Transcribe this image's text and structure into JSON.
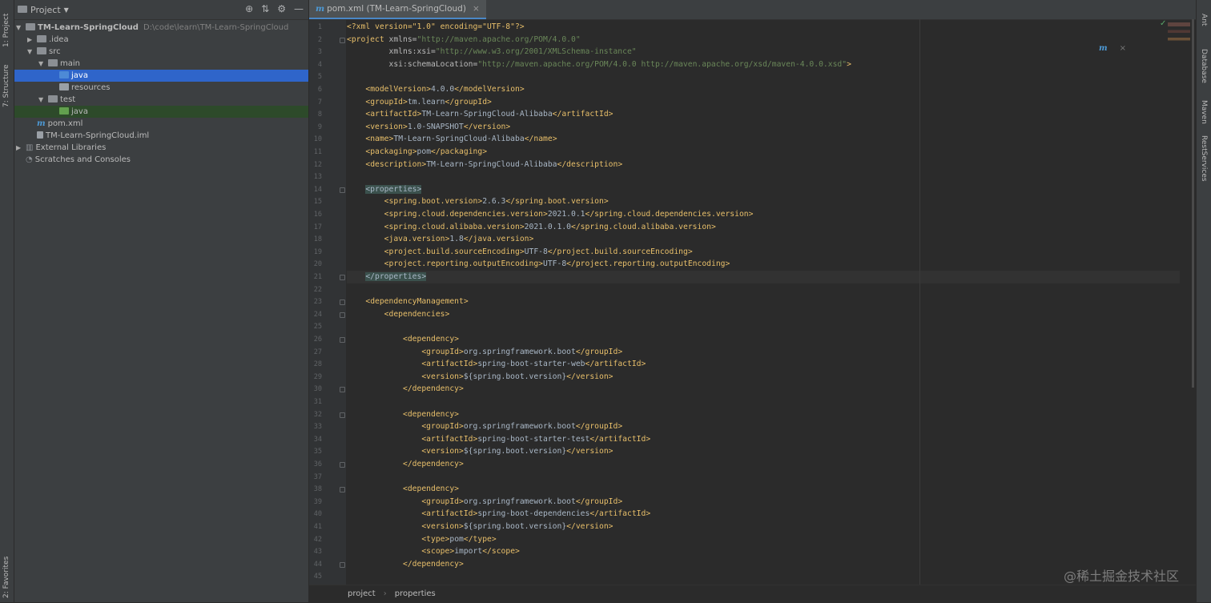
{
  "left_strip": {
    "tabs": [
      "1: Project",
      "7: Structure",
      "2: Favorites"
    ]
  },
  "right_strip": {
    "tabs": [
      "Ant",
      "Database",
      "Maven",
      "RestServices"
    ]
  },
  "project_panel": {
    "title": "Project",
    "tree": [
      {
        "label": "TM-Learn-SpringCloud",
        "path": "D:\\code\\learn\\TM-Learn-SpringCloud",
        "indent": 0,
        "arrow": "▼",
        "icon": "folder"
      },
      {
        "label": ".idea",
        "indent": 1,
        "arrow": "▶",
        "icon": "folder"
      },
      {
        "label": "src",
        "indent": 1,
        "arrow": "▼",
        "icon": "folder"
      },
      {
        "label": "main",
        "indent": 2,
        "arrow": "▼",
        "icon": "folder"
      },
      {
        "label": "java",
        "indent": 3,
        "arrow": "",
        "icon": "folder-blue",
        "selected": true
      },
      {
        "label": "resources",
        "indent": 3,
        "arrow": "",
        "icon": "folder-res"
      },
      {
        "label": "test",
        "indent": 2,
        "arrow": "▼",
        "icon": "folder"
      },
      {
        "label": "java",
        "indent": 3,
        "arrow": "",
        "icon": "folder-green",
        "selected2": true
      },
      {
        "label": "pom.xml",
        "indent": 1,
        "arrow": "",
        "icon": "maven"
      },
      {
        "label": "TM-Learn-SpringCloud.iml",
        "indent": 1,
        "arrow": "",
        "icon": "file"
      },
      {
        "label": "External Libraries",
        "indent": 0,
        "arrow": "▶",
        "icon": "lib"
      },
      {
        "label": "Scratches and Consoles",
        "indent": 0,
        "arrow": "",
        "icon": "scratch"
      }
    ]
  },
  "editor": {
    "tab_label": "pom.xml (TM-Learn-SpringCloud)",
    "current_line": 21,
    "lines": [
      [
        {
          "t": "pi",
          "v": "<?xml version=\"1.0\" encoding=\"UTF-8\"?>"
        }
      ],
      [
        {
          "t": "br",
          "v": "<"
        },
        {
          "t": "tg",
          "v": "project "
        },
        {
          "t": "an",
          "v": "xmlns="
        },
        {
          "t": "av",
          "v": "\"http://maven.apache.org/POM/4.0.0\""
        }
      ],
      [
        {
          "t": "an",
          "v": "         xmlns:xsi="
        },
        {
          "t": "av",
          "v": "\"http://www.w3.org/2001/XMLSchema-instance\""
        }
      ],
      [
        {
          "t": "an",
          "v": "         xsi:schemaLocation="
        },
        {
          "t": "av",
          "v": "\"http://maven.apache.org/POM/4.0.0 http://maven.apache.org/xsd/maven-4.0.0.xsd\""
        },
        {
          "t": "br",
          "v": ">"
        }
      ],
      [],
      [
        {
          "t": "x",
          "v": "    "
        },
        {
          "t": "br",
          "v": "<"
        },
        {
          "t": "tg",
          "v": "modelVersion"
        },
        {
          "t": "br",
          "v": ">"
        },
        {
          "t": "x",
          "v": "4.0.0"
        },
        {
          "t": "br",
          "v": "</"
        },
        {
          "t": "tg",
          "v": "modelVersion"
        },
        {
          "t": "br",
          "v": ">"
        }
      ],
      [
        {
          "t": "x",
          "v": "    "
        },
        {
          "t": "br",
          "v": "<"
        },
        {
          "t": "tg",
          "v": "groupId"
        },
        {
          "t": "br",
          "v": ">"
        },
        {
          "t": "x",
          "v": "tm.learn"
        },
        {
          "t": "br",
          "v": "</"
        },
        {
          "t": "tg",
          "v": "groupId"
        },
        {
          "t": "br",
          "v": ">"
        }
      ],
      [
        {
          "t": "x",
          "v": "    "
        },
        {
          "t": "br",
          "v": "<"
        },
        {
          "t": "tg",
          "v": "artifactId"
        },
        {
          "t": "br",
          "v": ">"
        },
        {
          "t": "x",
          "v": "TM-Learn-SpringCloud-Alibaba"
        },
        {
          "t": "br",
          "v": "</"
        },
        {
          "t": "tg",
          "v": "artifactId"
        },
        {
          "t": "br",
          "v": ">"
        }
      ],
      [
        {
          "t": "x",
          "v": "    "
        },
        {
          "t": "br",
          "v": "<"
        },
        {
          "t": "tg",
          "v": "version"
        },
        {
          "t": "br",
          "v": ">"
        },
        {
          "t": "x",
          "v": "1.0-SNAPSHOT"
        },
        {
          "t": "br",
          "v": "</"
        },
        {
          "t": "tg",
          "v": "version"
        },
        {
          "t": "br",
          "v": ">"
        }
      ],
      [
        {
          "t": "x",
          "v": "    "
        },
        {
          "t": "br",
          "v": "<"
        },
        {
          "t": "tg",
          "v": "name"
        },
        {
          "t": "br",
          "v": ">"
        },
        {
          "t": "x",
          "v": "TM-Learn-SpringCloud-Alibaba"
        },
        {
          "t": "br",
          "v": "</"
        },
        {
          "t": "tg",
          "v": "name"
        },
        {
          "t": "br",
          "v": ">"
        }
      ],
      [
        {
          "t": "x",
          "v": "    "
        },
        {
          "t": "br",
          "v": "<"
        },
        {
          "t": "tg",
          "v": "packaging"
        },
        {
          "t": "br",
          "v": ">"
        },
        {
          "t": "x",
          "v": "pom"
        },
        {
          "t": "br",
          "v": "</"
        },
        {
          "t": "tg",
          "v": "packaging"
        },
        {
          "t": "br",
          "v": ">"
        }
      ],
      [
        {
          "t": "x",
          "v": "    "
        },
        {
          "t": "br",
          "v": "<"
        },
        {
          "t": "tg",
          "v": "description"
        },
        {
          "t": "br",
          "v": ">"
        },
        {
          "t": "x",
          "v": "TM-Learn-SpringCloud-Alibaba"
        },
        {
          "t": "br",
          "v": "</"
        },
        {
          "t": "tg",
          "v": "description"
        },
        {
          "t": "br",
          "v": ">"
        }
      ],
      [],
      [
        {
          "t": "x",
          "v": "    "
        },
        {
          "t": "hl",
          "v": "<properties>"
        }
      ],
      [
        {
          "t": "x",
          "v": "        "
        },
        {
          "t": "br",
          "v": "<"
        },
        {
          "t": "tg",
          "v": "spring.boot.version"
        },
        {
          "t": "br",
          "v": ">"
        },
        {
          "t": "x",
          "v": "2.6.3"
        },
        {
          "t": "br",
          "v": "</"
        },
        {
          "t": "tg",
          "v": "spring.boot.version"
        },
        {
          "t": "br",
          "v": ">"
        }
      ],
      [
        {
          "t": "x",
          "v": "        "
        },
        {
          "t": "br",
          "v": "<"
        },
        {
          "t": "tg",
          "v": "spring.cloud.dependencies.version"
        },
        {
          "t": "br",
          "v": ">"
        },
        {
          "t": "x",
          "v": "2021.0.1"
        },
        {
          "t": "br",
          "v": "</"
        },
        {
          "t": "tg",
          "v": "spring.cloud.dependencies.version"
        },
        {
          "t": "br",
          "v": ">"
        }
      ],
      [
        {
          "t": "x",
          "v": "        "
        },
        {
          "t": "br",
          "v": "<"
        },
        {
          "t": "tg",
          "v": "spring.cloud.alibaba.version"
        },
        {
          "t": "br",
          "v": ">"
        },
        {
          "t": "x",
          "v": "2021.0.1.0"
        },
        {
          "t": "br",
          "v": "</"
        },
        {
          "t": "tg",
          "v": "spring.cloud.alibaba.version"
        },
        {
          "t": "br",
          "v": ">"
        }
      ],
      [
        {
          "t": "x",
          "v": "        "
        },
        {
          "t": "br",
          "v": "<"
        },
        {
          "t": "tg",
          "v": "java.version"
        },
        {
          "t": "br",
          "v": ">"
        },
        {
          "t": "x",
          "v": "1.8"
        },
        {
          "t": "br",
          "v": "</"
        },
        {
          "t": "tg",
          "v": "java.version"
        },
        {
          "t": "br",
          "v": ">"
        }
      ],
      [
        {
          "t": "x",
          "v": "        "
        },
        {
          "t": "br",
          "v": "<"
        },
        {
          "t": "tg",
          "v": "project.build.sourceEncoding"
        },
        {
          "t": "br",
          "v": ">"
        },
        {
          "t": "x",
          "v": "UTF-8"
        },
        {
          "t": "br",
          "v": "</"
        },
        {
          "t": "tg",
          "v": "project.build.sourceEncoding"
        },
        {
          "t": "br",
          "v": ">"
        }
      ],
      [
        {
          "t": "x",
          "v": "        "
        },
        {
          "t": "br",
          "v": "<"
        },
        {
          "t": "tg",
          "v": "project.reporting.outputEncoding"
        },
        {
          "t": "br",
          "v": ">"
        },
        {
          "t": "x",
          "v": "UTF-8"
        },
        {
          "t": "br",
          "v": "</"
        },
        {
          "t": "tg",
          "v": "project.reporting.outputEncoding"
        },
        {
          "t": "br",
          "v": ">"
        }
      ],
      [
        {
          "t": "x",
          "v": "    "
        },
        {
          "t": "hl",
          "v": "</properties>"
        }
      ],
      [],
      [
        {
          "t": "x",
          "v": "    "
        },
        {
          "t": "br",
          "v": "<"
        },
        {
          "t": "tg",
          "v": "dependencyManagement"
        },
        {
          "t": "br",
          "v": ">"
        }
      ],
      [
        {
          "t": "x",
          "v": "        "
        },
        {
          "t": "br",
          "v": "<"
        },
        {
          "t": "tg",
          "v": "dependencies"
        },
        {
          "t": "br",
          "v": ">"
        }
      ],
      [],
      [
        {
          "t": "x",
          "v": "            "
        },
        {
          "t": "br",
          "v": "<"
        },
        {
          "t": "tg",
          "v": "dependency"
        },
        {
          "t": "br",
          "v": ">"
        }
      ],
      [
        {
          "t": "x",
          "v": "                "
        },
        {
          "t": "br",
          "v": "<"
        },
        {
          "t": "tg",
          "v": "groupId"
        },
        {
          "t": "br",
          "v": ">"
        },
        {
          "t": "x",
          "v": "org.springframework.boot"
        },
        {
          "t": "br",
          "v": "</"
        },
        {
          "t": "tg",
          "v": "groupId"
        },
        {
          "t": "br",
          "v": ">"
        }
      ],
      [
        {
          "t": "x",
          "v": "                "
        },
        {
          "t": "br",
          "v": "<"
        },
        {
          "t": "tg",
          "v": "artifactId"
        },
        {
          "t": "br",
          "v": ">"
        },
        {
          "t": "x",
          "v": "spring-boot-starter-web"
        },
        {
          "t": "br",
          "v": "</"
        },
        {
          "t": "tg",
          "v": "artifactId"
        },
        {
          "t": "br",
          "v": ">"
        }
      ],
      [
        {
          "t": "x",
          "v": "                "
        },
        {
          "t": "br",
          "v": "<"
        },
        {
          "t": "tg",
          "v": "version"
        },
        {
          "t": "br",
          "v": ">"
        },
        {
          "t": "x",
          "v": "${spring.boot.version}"
        },
        {
          "t": "br",
          "v": "</"
        },
        {
          "t": "tg",
          "v": "version"
        },
        {
          "t": "br",
          "v": ">"
        }
      ],
      [
        {
          "t": "x",
          "v": "            "
        },
        {
          "t": "br",
          "v": "</"
        },
        {
          "t": "tg",
          "v": "dependency"
        },
        {
          "t": "br",
          "v": ">"
        }
      ],
      [],
      [
        {
          "t": "x",
          "v": "            "
        },
        {
          "t": "br",
          "v": "<"
        },
        {
          "t": "tg",
          "v": "dependency"
        },
        {
          "t": "br",
          "v": ">"
        }
      ],
      [
        {
          "t": "x",
          "v": "                "
        },
        {
          "t": "br",
          "v": "<"
        },
        {
          "t": "tg",
          "v": "groupId"
        },
        {
          "t": "br",
          "v": ">"
        },
        {
          "t": "x",
          "v": "org.springframework.boot"
        },
        {
          "t": "br",
          "v": "</"
        },
        {
          "t": "tg",
          "v": "groupId"
        },
        {
          "t": "br",
          "v": ">"
        }
      ],
      [
        {
          "t": "x",
          "v": "                "
        },
        {
          "t": "br",
          "v": "<"
        },
        {
          "t": "tg",
          "v": "artifactId"
        },
        {
          "t": "br",
          "v": ">"
        },
        {
          "t": "x",
          "v": "spring-boot-starter-test"
        },
        {
          "t": "br",
          "v": "</"
        },
        {
          "t": "tg",
          "v": "artifactId"
        },
        {
          "t": "br",
          "v": ">"
        }
      ],
      [
        {
          "t": "x",
          "v": "                "
        },
        {
          "t": "br",
          "v": "<"
        },
        {
          "t": "tg",
          "v": "version"
        },
        {
          "t": "br",
          "v": ">"
        },
        {
          "t": "x",
          "v": "${spring.boot.version}"
        },
        {
          "t": "br",
          "v": "</"
        },
        {
          "t": "tg",
          "v": "version"
        },
        {
          "t": "br",
          "v": ">"
        }
      ],
      [
        {
          "t": "x",
          "v": "            "
        },
        {
          "t": "br",
          "v": "</"
        },
        {
          "t": "tg",
          "v": "dependency"
        },
        {
          "t": "br",
          "v": ">"
        }
      ],
      [],
      [
        {
          "t": "x",
          "v": "            "
        },
        {
          "t": "br",
          "v": "<"
        },
        {
          "t": "tg",
          "v": "dependency"
        },
        {
          "t": "br",
          "v": ">"
        }
      ],
      [
        {
          "t": "x",
          "v": "                "
        },
        {
          "t": "br",
          "v": "<"
        },
        {
          "t": "tg",
          "v": "groupId"
        },
        {
          "t": "br",
          "v": ">"
        },
        {
          "t": "x",
          "v": "org.springframework.boot"
        },
        {
          "t": "br",
          "v": "</"
        },
        {
          "t": "tg",
          "v": "groupId"
        },
        {
          "t": "br",
          "v": ">"
        }
      ],
      [
        {
          "t": "x",
          "v": "                "
        },
        {
          "t": "br",
          "v": "<"
        },
        {
          "t": "tg",
          "v": "artifactId"
        },
        {
          "t": "br",
          "v": ">"
        },
        {
          "t": "x",
          "v": "spring-boot-dependencies"
        },
        {
          "t": "br",
          "v": "</"
        },
        {
          "t": "tg",
          "v": "artifactId"
        },
        {
          "t": "br",
          "v": ">"
        }
      ],
      [
        {
          "t": "x",
          "v": "                "
        },
        {
          "t": "br",
          "v": "<"
        },
        {
          "t": "tg",
          "v": "version"
        },
        {
          "t": "br",
          "v": ">"
        },
        {
          "t": "x",
          "v": "${spring.boot.version}"
        },
        {
          "t": "br",
          "v": "</"
        },
        {
          "t": "tg",
          "v": "version"
        },
        {
          "t": "br",
          "v": ">"
        }
      ],
      [
        {
          "t": "x",
          "v": "                "
        },
        {
          "t": "br",
          "v": "<"
        },
        {
          "t": "tg",
          "v": "type"
        },
        {
          "t": "br",
          "v": ">"
        },
        {
          "t": "x",
          "v": "pom"
        },
        {
          "t": "br",
          "v": "</"
        },
        {
          "t": "tg",
          "v": "type"
        },
        {
          "t": "br",
          "v": ">"
        }
      ],
      [
        {
          "t": "x",
          "v": "                "
        },
        {
          "t": "br",
          "v": "<"
        },
        {
          "t": "tg",
          "v": "scope"
        },
        {
          "t": "br",
          "v": ">"
        },
        {
          "t": "x",
          "v": "import"
        },
        {
          "t": "br",
          "v": "</"
        },
        {
          "t": "tg",
          "v": "scope"
        },
        {
          "t": "br",
          "v": ">"
        }
      ],
      [
        {
          "t": "x",
          "v": "            "
        },
        {
          "t": "br",
          "v": "</"
        },
        {
          "t": "tg",
          "v": "dependency"
        },
        {
          "t": "br",
          "v": ">"
        }
      ],
      []
    ]
  },
  "breadcrumb": {
    "items": [
      "project",
      "properties"
    ]
  },
  "watermark": "@稀土掘金技术社区",
  "colors": {
    "accent": "#2f65ca",
    "tag": "#e8bf6a",
    "value": "#6a8759"
  }
}
